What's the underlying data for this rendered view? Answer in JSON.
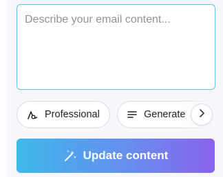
{
  "editor": {
    "placeholder": "Describe your email content...",
    "value": ""
  },
  "chips": [
    {
      "label": "Professional",
      "icon": "tone-icon"
    },
    {
      "label": "Generate",
      "icon": "lines-icon"
    }
  ],
  "scroll_button": {
    "icon": "chevron-right-icon"
  },
  "update_button": {
    "label": "Update content",
    "icon": "magic-wand-icon"
  },
  "colors": {
    "border_active": "#5ec3e6",
    "button_gradient_start": "#3db9ea",
    "button_gradient_end": "#8a63ec",
    "panel_bg": "#f6f8fc"
  }
}
